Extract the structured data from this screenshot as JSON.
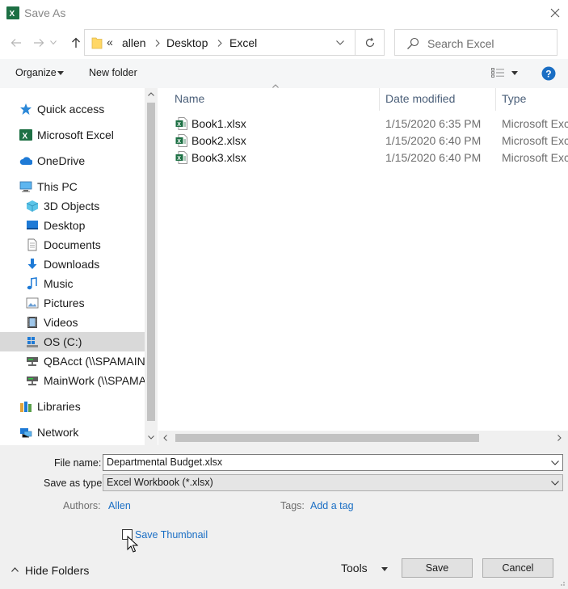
{
  "window": {
    "title": "Save As"
  },
  "address": {
    "overflow": "«",
    "breadcrumbs": [
      "allen",
      "Desktop",
      "Excel"
    ]
  },
  "search": {
    "placeholder": "Search Excel"
  },
  "toolbar": {
    "organize": "Organize",
    "new_folder": "New folder"
  },
  "nav": {
    "items": [
      {
        "label": "Quick access",
        "icon": "star-icon"
      },
      {
        "label": "Microsoft Excel",
        "icon": "excel-icon"
      },
      {
        "label": "OneDrive",
        "icon": "cloud-icon"
      },
      {
        "label": "This PC",
        "icon": "computer-icon"
      },
      {
        "label": "3D Objects",
        "icon": "cube-icon"
      },
      {
        "label": "Desktop",
        "icon": "desktop-icon"
      },
      {
        "label": "Documents",
        "icon": "document-icon"
      },
      {
        "label": "Downloads",
        "icon": "download-icon"
      },
      {
        "label": "Music",
        "icon": "music-icon"
      },
      {
        "label": "Pictures",
        "icon": "pictures-icon"
      },
      {
        "label": "Videos",
        "icon": "video-icon"
      },
      {
        "label": "OS (C:)",
        "icon": "drive-icon",
        "selected": true
      },
      {
        "label": "QBAcct (\\\\SPAMAIN)",
        "icon": "network-drive-icon"
      },
      {
        "label": "MainWork (\\\\SPAMA",
        "icon": "network-drive-icon"
      },
      {
        "label": "Libraries",
        "icon": "libraries-icon"
      },
      {
        "label": "Network",
        "icon": "network-icon"
      }
    ]
  },
  "files": {
    "columns": {
      "name": "Name",
      "date": "Date modified",
      "type": "Type"
    },
    "rows": [
      {
        "name": "Book1.xlsx",
        "date": "1/15/2020 6:35 PM",
        "type": "Microsoft Excel"
      },
      {
        "name": "Book2.xlsx",
        "date": "1/15/2020 6:40 PM",
        "type": "Microsoft Excel"
      },
      {
        "name": "Book3.xlsx",
        "date": "1/15/2020 6:40 PM",
        "type": "Microsoft Excel"
      }
    ]
  },
  "form": {
    "file_name_label": "File name:",
    "file_name_value": "Departmental Budget.xlsx",
    "save_type_label": "Save as type:",
    "save_type_value": "Excel Workbook (*.xlsx)",
    "authors_label": "Authors:",
    "authors_value": "Allen",
    "tags_label": "Tags:",
    "tags_value": "Add a tag",
    "thumbnail_label": "Save Thumbnail"
  },
  "footer": {
    "hide_folders": "Hide Folders",
    "tools": "Tools",
    "save": "Save",
    "cancel": "Cancel"
  },
  "colors": {
    "accent": "#1a6ec4",
    "excel_green": "#1d7044",
    "selection": "#d9d9d9"
  }
}
